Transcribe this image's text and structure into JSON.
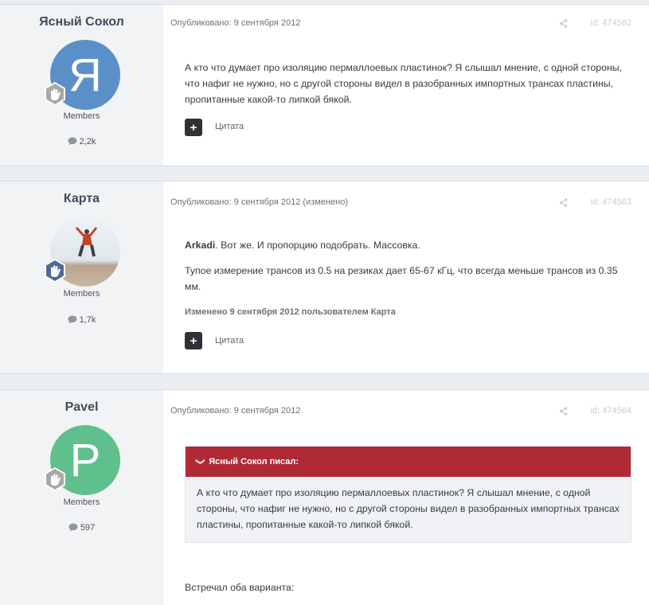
{
  "posts": [
    {
      "author": "Ясный Сокол",
      "avatar_letter": "Я",
      "avatar_color": "#5b8fc7",
      "group": "Members",
      "count": "2,2k",
      "date": "Опубликовано: 9 сентября 2012",
      "id": "id: 474562",
      "body": [
        "А кто что думает про изоляцию пермаллоевых пластинок? Я слышал мнение, с одной стороны, что нафиг не нужно, но с другой стороны видел в разобранных импортных трансах пластины, пропитанные какой-то липкой бякой."
      ],
      "quote_label": "Цитата"
    },
    {
      "author": "Карта",
      "group": "Members",
      "count": "1,7k",
      "date": "Опубликовано: 9 сентября 2012 (изменено)",
      "id": "id: 474563",
      "mention": "Arkadi",
      "body_first_rest": ". Вот же. И пропорцию подобрать. Массовка.",
      "body": [
        "Тупое измерение трансов из 0.5 на резиках дает 65-67 кГц, что всегда меньше трансов из 0.35 мм."
      ],
      "edited": "Изменено 9 сентября 2012 пользователем Карта",
      "quote_label": "Цитата"
    },
    {
      "author": "Pavel",
      "avatar_letter": "P",
      "avatar_color": "#5fc08e",
      "group": "Members",
      "count": "597",
      "date": "Опубликовано: 9 сентября 2012",
      "id": "id: 474564",
      "quote_header": "Ясный Сокол писал:",
      "quote_text": "А кто что думает про изоляцию пермаллоевых пластинок? Я слышал мнение, с одной стороны, что нафиг не нужно, но с другой стороны видел в разобранных импортных трансах пластины, пропитанные какой-то липкой бякой.",
      "body": [
        "Встречал оба варианта:"
      ]
    }
  ],
  "icons": {
    "badge": "rank-badge-icon",
    "comment": "comment-icon",
    "share": "share-icon",
    "plus": "plus-icon",
    "chevron": "chevron-down-icon"
  }
}
